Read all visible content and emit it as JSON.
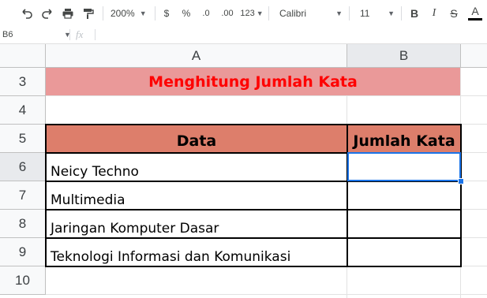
{
  "toolbar": {
    "zoom": "200%",
    "currency": "$",
    "percent": "%",
    "decrease_decimal": ".0",
    "increase_decimal": ".00",
    "more_formats": "123",
    "font": "Calibri",
    "font_size": "11",
    "bold": "B",
    "italic": "I",
    "strikethrough": "S",
    "text_color": "A"
  },
  "formula_bar": {
    "name_box": "B6",
    "fx": "fx",
    "value": ""
  },
  "columns": [
    "A",
    "B"
  ],
  "rows": [
    "3",
    "4",
    "5",
    "6",
    "7",
    "8",
    "9",
    "10"
  ],
  "sheet": {
    "title": "Menghitung Jumlah Kata",
    "header_data": "Data",
    "header_count": "Jumlah Kata",
    "items": [
      "Neicy Techno",
      "Multimedia",
      "Jaringan Komputer Dasar",
      "Teknologi Informasi dan Komunikasi"
    ]
  },
  "colors": {
    "title_fill": "#ea9999",
    "title_text": "#ff0000",
    "header_fill": "#dd7e6b",
    "selection": "#1a73e8"
  }
}
